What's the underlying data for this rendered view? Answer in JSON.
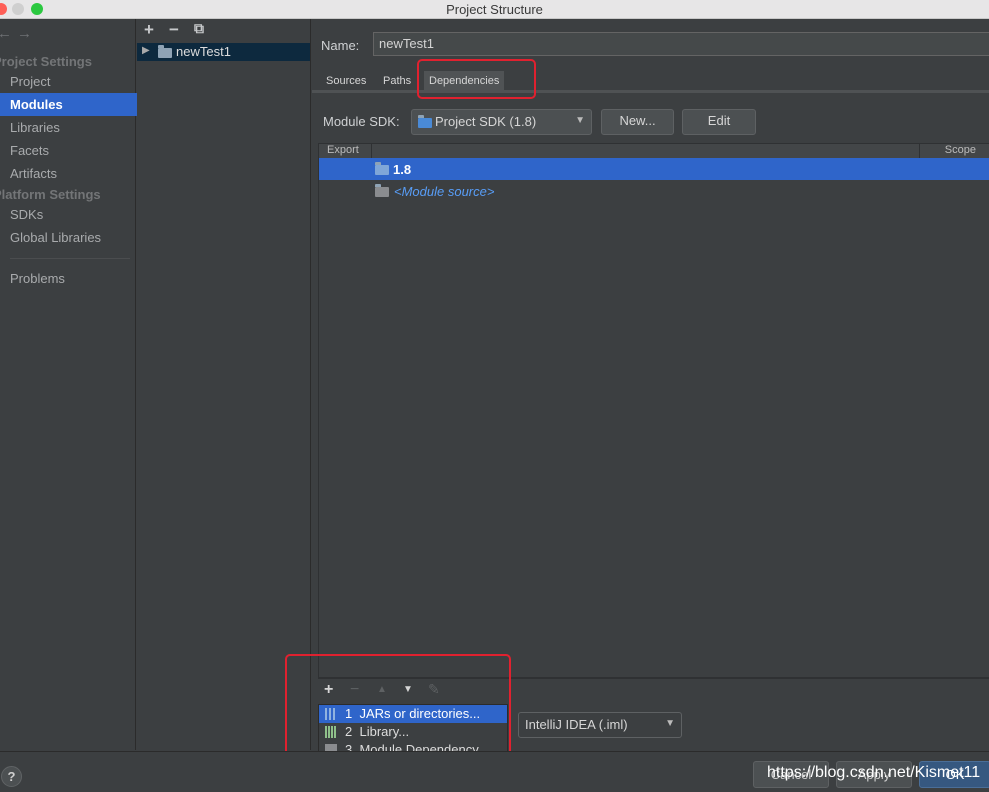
{
  "window": {
    "title": "Project Structure"
  },
  "left_nav": {
    "back_glyph": "←",
    "forward_glyph": "→",
    "project_settings_header": "Project Settings",
    "project_items": [
      "Project",
      "Modules",
      "Libraries",
      "Facets",
      "Artifacts"
    ],
    "platform_settings_header": "Platform Settings",
    "platform_items": [
      "SDKs",
      "Global Libraries"
    ],
    "problems": "Problems",
    "selected": "Modules"
  },
  "tree": {
    "toolbar": {
      "add": "+",
      "remove": "−",
      "copy": "⧉"
    },
    "module": "newTest1"
  },
  "module": {
    "name_label": "Name:",
    "name_value": "newTest1",
    "tabs": [
      "Sources",
      "Paths",
      "Dependencies"
    ],
    "active_tab": "Dependencies",
    "sdk_label": "Module SDK:",
    "sdk_value": "Project SDK (1.8)",
    "new_button": "New...",
    "edit_button": "Edit",
    "table": {
      "headers": [
        "Export",
        "Scope"
      ],
      "rows": [
        {
          "label": "1.8",
          "selected": true
        },
        {
          "label": "<Module source>",
          "selected": false
        }
      ]
    },
    "bottom_toolbar": {
      "add": "+",
      "remove": "−",
      "up": "▲",
      "down": "▼",
      "edit": "✎"
    },
    "format_value": "IntelliJ IDEA (.iml)"
  },
  "add_menu": [
    {
      "num": "1",
      "label": "JARs or directories...",
      "selected": true
    },
    {
      "num": "2",
      "label": "Library...",
      "selected": false
    },
    {
      "num": "3",
      "label": "Module Dependency...",
      "selected": false
    }
  ],
  "footer": {
    "help": "?",
    "cancel": "Cancel",
    "apply": "Apply",
    "ok": "OK",
    "watermark": "https://blog.csdn.net/Kismet11"
  },
  "colors": {
    "selection": "#2f65ca",
    "highlight_box": "#e0212f",
    "link": "#589df6"
  }
}
